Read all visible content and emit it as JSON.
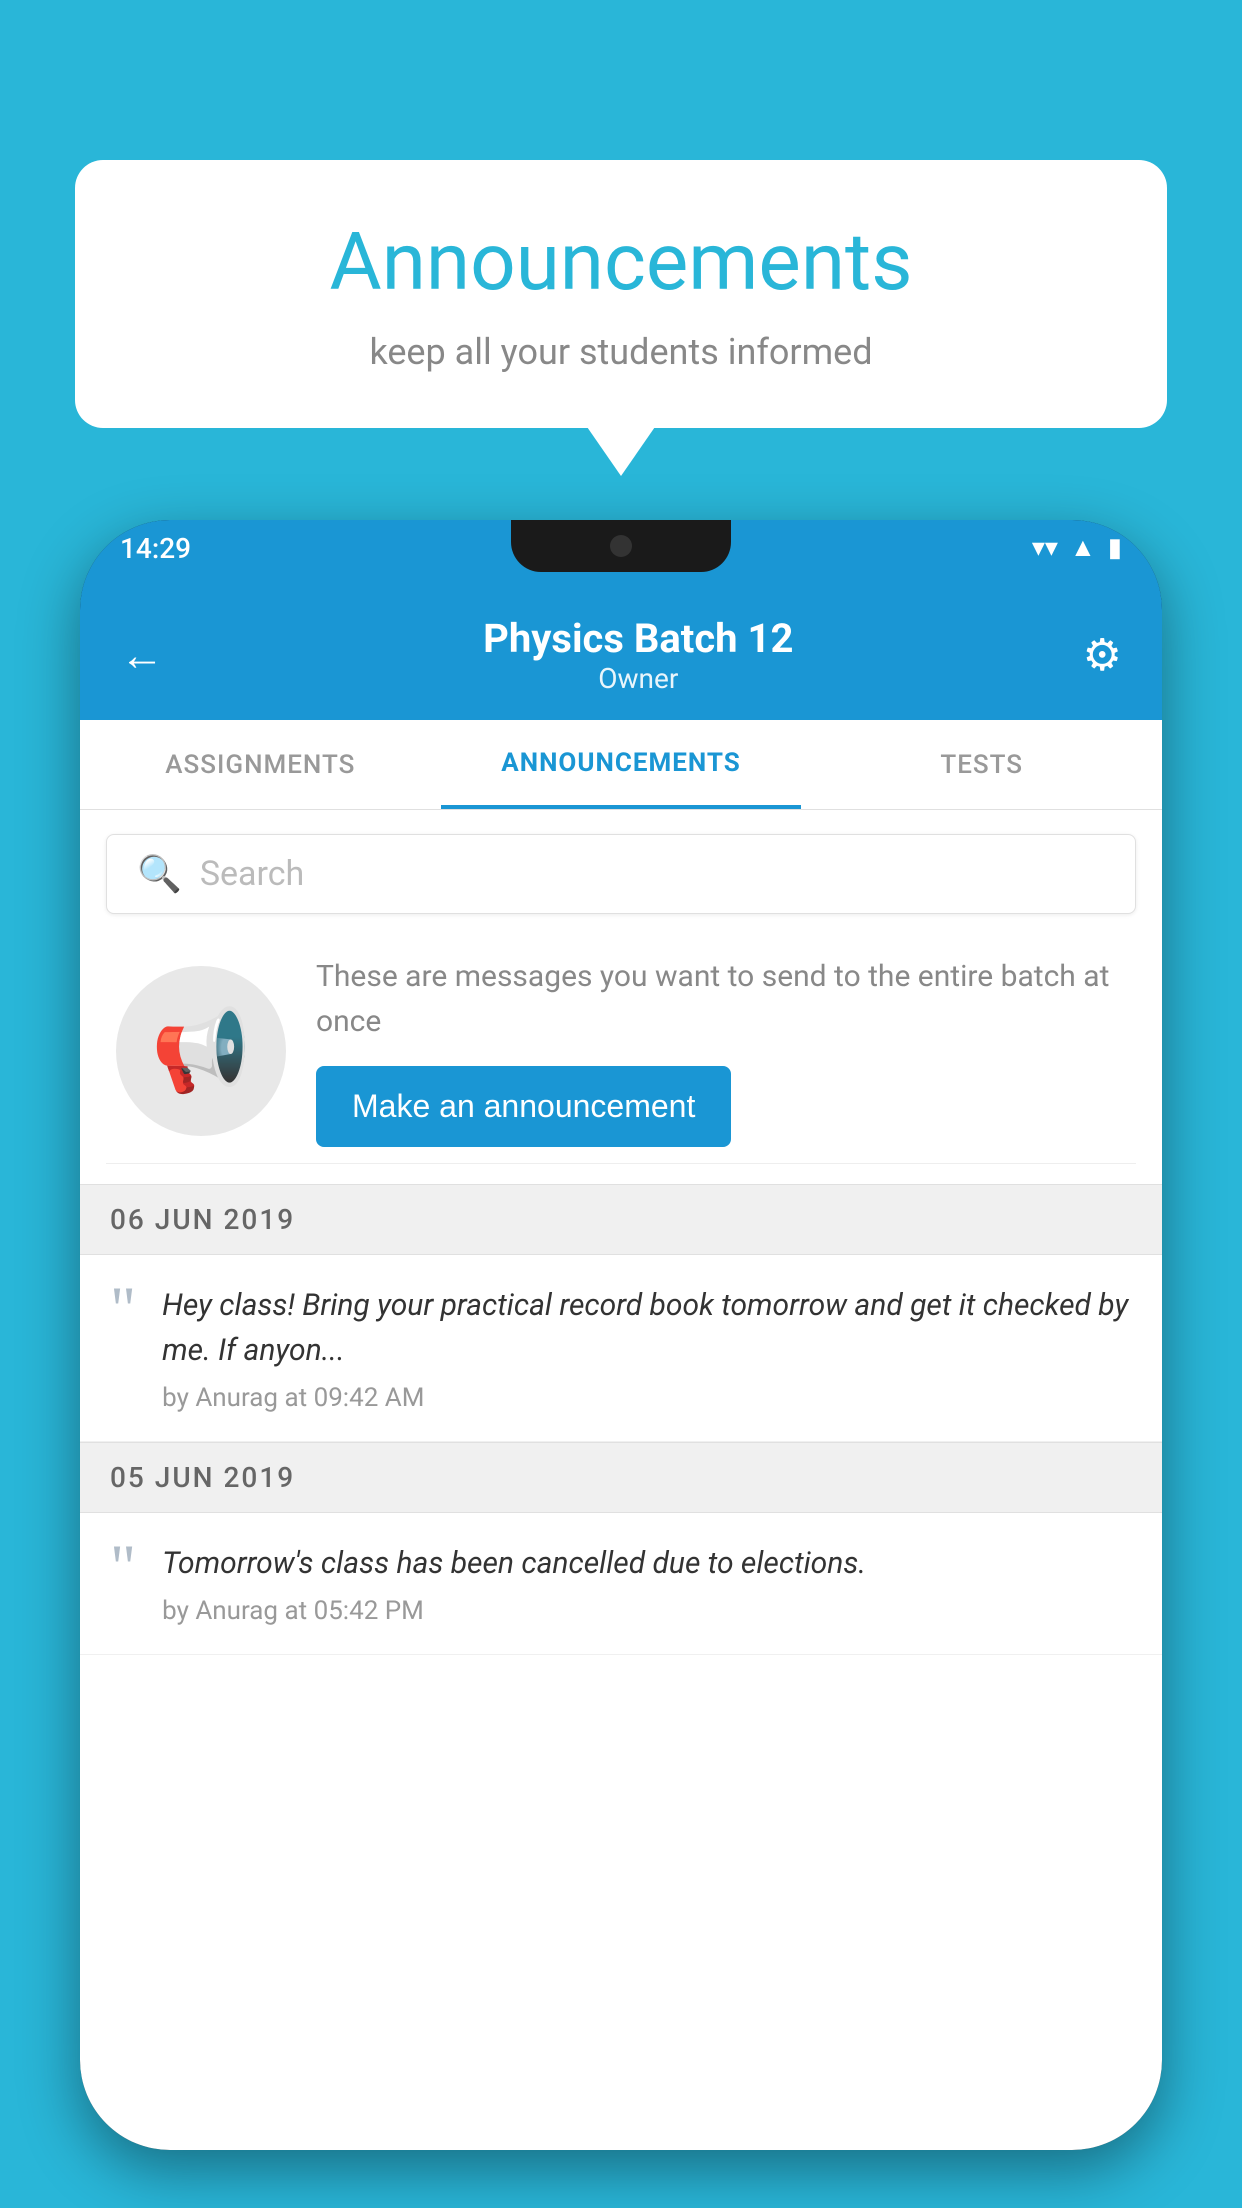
{
  "background": {
    "color": "#29b6d8"
  },
  "speech_bubble": {
    "title": "Announcements",
    "subtitle": "keep all your students informed"
  },
  "phone": {
    "status_bar": {
      "time": "14:29"
    },
    "app_bar": {
      "title": "Physics Batch 12",
      "subtitle": "Owner",
      "back_label": "←",
      "settings_label": "⚙"
    },
    "tabs": [
      {
        "label": "ASSIGNMENTS",
        "active": false
      },
      {
        "label": "ANNOUNCEMENTS",
        "active": true
      },
      {
        "label": "TESTS",
        "active": false
      }
    ],
    "search": {
      "placeholder": "Search"
    },
    "promo": {
      "description": "These are messages you want to send to the entire batch at once",
      "button_label": "Make an announcement"
    },
    "announcements": [
      {
        "date": "06  JUN  2019",
        "text": "Hey class! Bring your practical record book tomorrow and get it checked by me. If anyon...",
        "meta": "by Anurag at 09:42 AM"
      },
      {
        "date": "05  JUN  2019",
        "text": "Tomorrow's class has been cancelled due to elections.",
        "meta": "by Anurag at 05:42 PM"
      }
    ]
  }
}
